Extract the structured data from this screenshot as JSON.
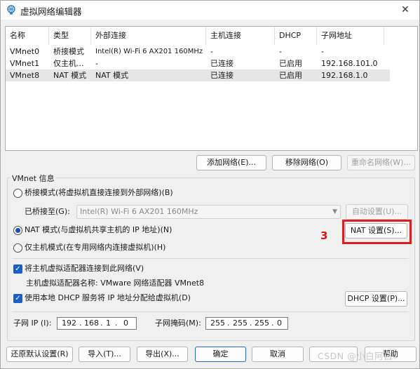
{
  "window": {
    "title": "虚拟网络编辑器",
    "close_glyph": "✕",
    "icon": "network-globe-icon"
  },
  "network_list": {
    "columns": [
      "名称",
      "类型",
      "外部连接",
      "主机连接",
      "DHCP",
      "子网地址"
    ],
    "rows": [
      {
        "name": "VMnet0",
        "type": "桥接模式",
        "external": "Intel(R) Wi-Fi 6 AX201 160MHz",
        "host": "-",
        "dhcp": "-",
        "subnet": "-"
      },
      {
        "name": "VMnet1",
        "type": "仅主机...",
        "external": "-",
        "host": "已连接",
        "dhcp": "已启用",
        "subnet": "192.168.101.0"
      },
      {
        "name": "VMnet8",
        "type": "NAT 模式",
        "external": "NAT 模式",
        "host": "已连接",
        "dhcp": "已启用",
        "subnet": "192.168.1.0"
      }
    ],
    "selected_row": "VMnet8"
  },
  "list_buttons": {
    "add": "添加网络(E)...",
    "remove": "移除网络(O)",
    "rename": "重命名网络(W)..."
  },
  "vmnet_info": {
    "group_title": "VMnet 信息",
    "bridge_label": "桥接模式(将虚拟机直接连接到外部网络)(B)",
    "bridged_to_label": "已桥接至(G):",
    "bridged_to_value": "Intel(R) Wi-Fi 6 AX201 160MHz",
    "auto_settings": "自动设置(U)...",
    "nat_label": "NAT 模式(与虚拟机共享主机的 IP 地址)(N)",
    "nat_settings": "NAT 设置(S)...",
    "hostonly_label": "仅主机模式(在专用网络内连接虚拟机)(H)",
    "selected_mode": "nat",
    "connect_adapter_label": "将主机虚拟适配器连接到此网络(V)",
    "adapter_name_text": "主机虚拟适配器名称: VMware 网络适配器 VMnet8",
    "dhcp_label": "使用本地 DHCP 服务将 IP 地址分配给虚拟机(D)",
    "dhcp_settings": "DHCP 设置(P)...",
    "subnet_ip_label": "子网 IP (I):",
    "subnet_ip": [
      "192",
      "168",
      "1",
      "0"
    ],
    "subnet_mask_label": "子网掩码(M):",
    "subnet_mask": [
      "255",
      "255",
      "255",
      "0"
    ]
  },
  "annotation": {
    "step_number": "3",
    "highlight_color": "#d9201e"
  },
  "footer_buttons": {
    "restore": "还原默认设置(R)",
    "import": "导入(T)...",
    "export": "导出(X)...",
    "ok": "确定",
    "cancel": "取消",
    "help": "帮助"
  },
  "watermark": "CSDN @小白阿白"
}
